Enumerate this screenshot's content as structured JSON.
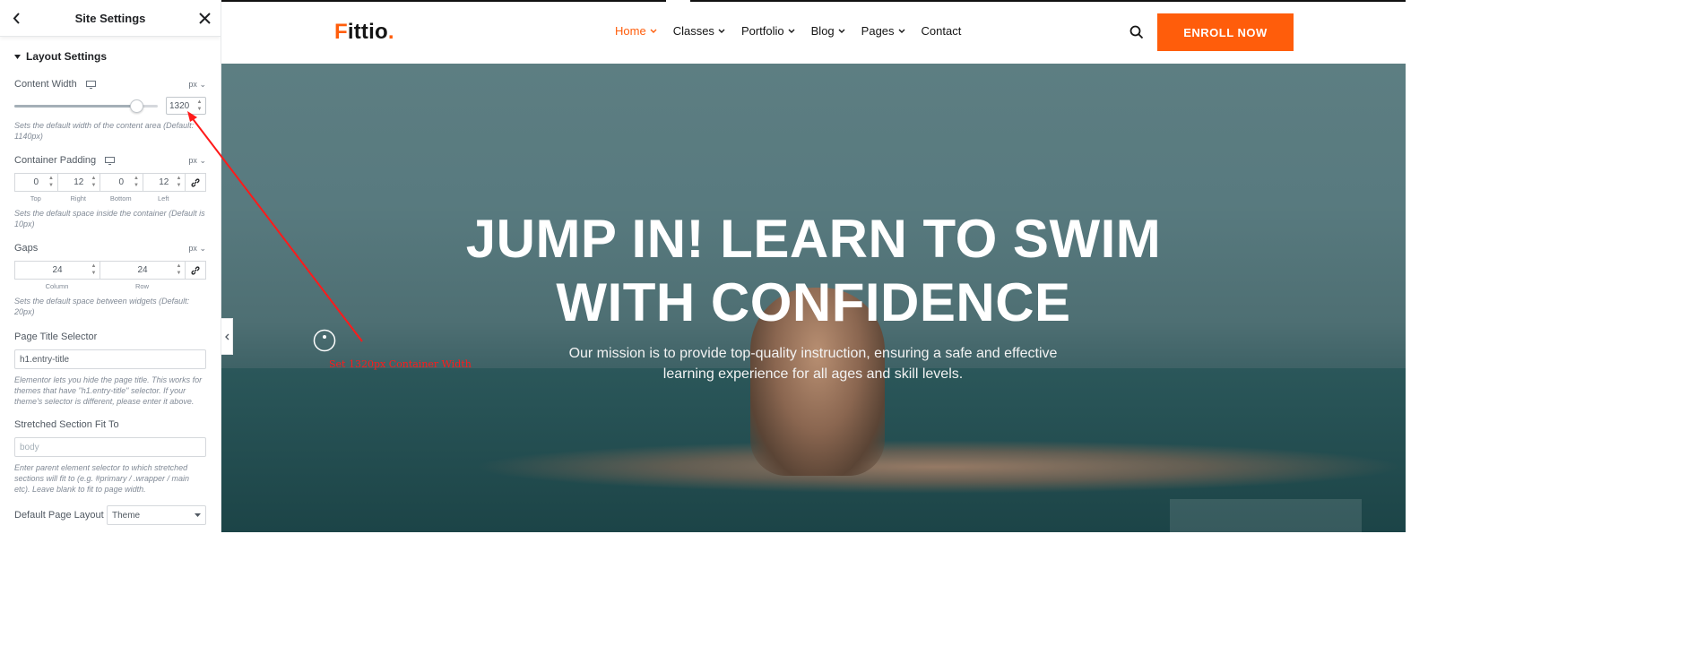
{
  "panel": {
    "title": "Site Settings",
    "section_title": "Layout Settings",
    "content_width": {
      "label": "Content Width",
      "unit": "px",
      "value": "1320",
      "slider_fraction": 0.85,
      "help": "Sets the default width of the content area (Default: 1140px)"
    },
    "container_padding": {
      "label": "Container Padding",
      "unit": "px",
      "values": [
        "0",
        "12",
        "0",
        "12"
      ],
      "captions": [
        "Top",
        "Right",
        "Bottom",
        "Left"
      ],
      "help": "Sets the default space inside the container (Default is 10px)"
    },
    "gaps": {
      "label": "Gaps",
      "unit": "px",
      "values": [
        "24",
        "24"
      ],
      "captions": [
        "Column",
        "Row"
      ],
      "help": "Sets the default space between widgets (Default: 20px)"
    },
    "page_title_selector": {
      "label": "Page Title Selector",
      "value": "h1.entry-title",
      "help": "Elementor lets you hide the page title. This works for themes that have \"h1.entry-title\" selector. If your theme's selector is different, please enter it above."
    },
    "stretched_section": {
      "label": "Stretched Section Fit To",
      "placeholder": "body",
      "help": "Enter parent element selector to which stretched sections will fit to (e.g. #primary / .wrapper / main etc). Leave blank to fit to page width."
    },
    "default_page_layout": {
      "label": "Default Page Layout",
      "value": "Theme"
    }
  },
  "site": {
    "logo_first": "F",
    "logo_rest": "ittio",
    "logo_dot": ".",
    "nav": [
      "Home",
      "Classes",
      "Portfolio",
      "Blog",
      "Pages",
      "Contact"
    ],
    "enroll_label": "ENROLL NOW",
    "hero_title_line1": "JUMP IN! LEARN TO SWIM",
    "hero_title_line2": "WITH CONFIDENCE",
    "hero_subtitle": "Our mission is to provide top-quality instruction, ensuring a safe and effective learning experience for all ages and skill levels."
  },
  "annotation": {
    "text": "Set 1320px Container Width",
    "color": "#ff1a1a"
  },
  "colors": {
    "accent": "#ff5d0b",
    "panel_text": "#515962"
  }
}
